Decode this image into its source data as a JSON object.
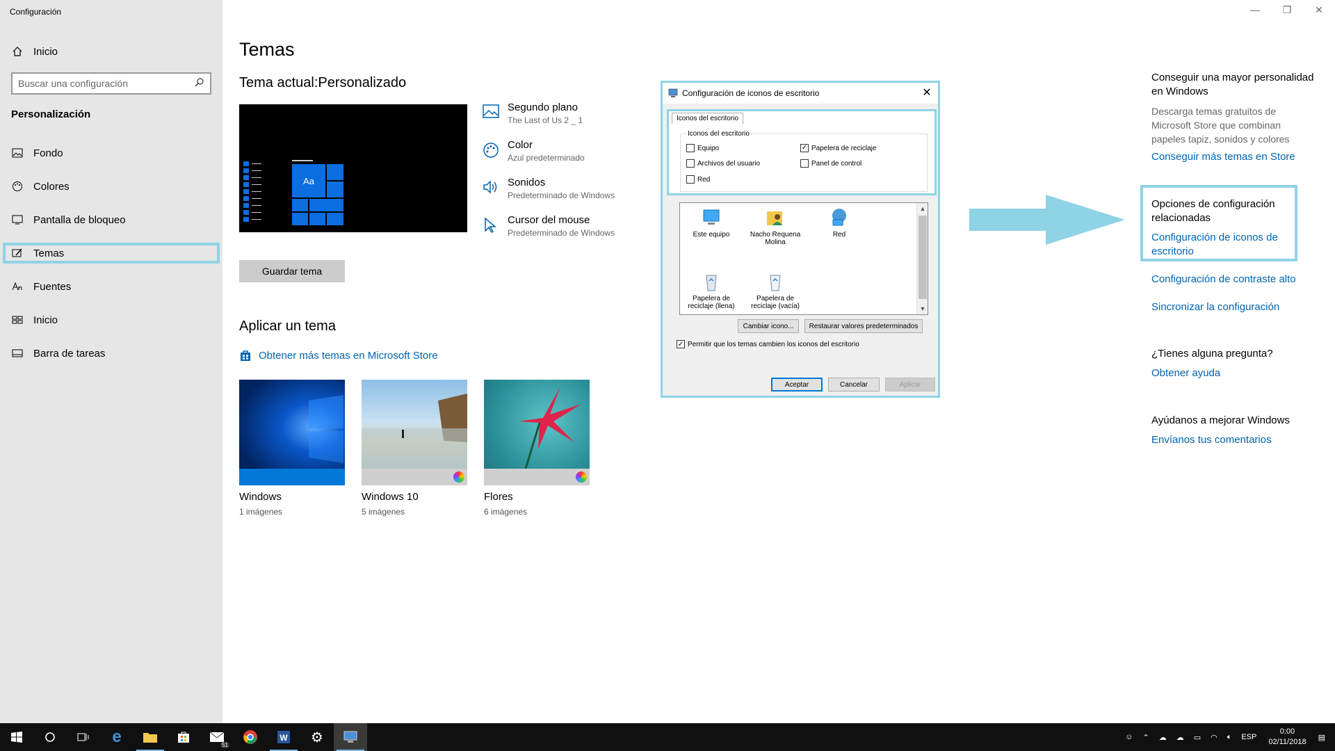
{
  "app_title": "Configuración",
  "sidebar": {
    "home_label": "Inicio",
    "search_placeholder": "Buscar una configuración",
    "section_heading": "Personalización",
    "items": [
      {
        "label": "Fondo",
        "icon": "picture-icon"
      },
      {
        "label": "Colores",
        "icon": "palette-icon"
      },
      {
        "label": "Pantalla de bloqueo",
        "icon": "monitor-icon"
      },
      {
        "label": "Temas",
        "icon": "brush-icon",
        "active": true
      },
      {
        "label": "Fuentes",
        "icon": "font-icon"
      },
      {
        "label": "Inicio",
        "icon": "start-icon"
      },
      {
        "label": "Barra de tareas",
        "icon": "taskbar-icon"
      }
    ]
  },
  "main": {
    "title": "Temas",
    "current_theme": "Tema actual:Personalizado",
    "preview_tile_label": "Aa",
    "save_button": "Guardar tema",
    "settings": [
      {
        "title": "Segundo plano",
        "subtitle": "The Last of Us 2 _ 1",
        "icon": "picture-icon"
      },
      {
        "title": "Color",
        "subtitle": "Azul predeterminado",
        "icon": "palette-icon"
      },
      {
        "title": "Sonidos",
        "subtitle": "Predeterminado de Windows",
        "icon": "speaker-icon"
      },
      {
        "title": "Cursor del mouse",
        "subtitle": "Predeterminado de Windows",
        "icon": "cursor-icon"
      }
    ],
    "apply_heading": "Aplicar un tema",
    "store_link": "Obtener más temas en Microsoft Store",
    "themes": [
      {
        "name": "Windows",
        "count": "1 imágenes"
      },
      {
        "name": "Windows 10",
        "count": "5 imágenes"
      },
      {
        "name": "Flores",
        "count": "6 imágenes"
      }
    ]
  },
  "dialog": {
    "title": "Configuración de iconos de escritorio",
    "tab": "Iconos del escritorio",
    "group_label": "Iconos del escritorio",
    "checkboxes": [
      {
        "label": "Equipo",
        "checked": false
      },
      {
        "label": "Papelera de reciclaje",
        "checked": true
      },
      {
        "label": "Archivos del usuario",
        "checked": false
      },
      {
        "label": "Panel de control",
        "checked": false
      },
      {
        "label": "Red",
        "checked": false
      }
    ],
    "icons": [
      {
        "label": "Este equipo"
      },
      {
        "label": "Nacho Requena Molina"
      },
      {
        "label": "Red"
      },
      {
        "label": "Papelera de reciclaje (llena)"
      },
      {
        "label": "Papelera de reciclaje (vacía)"
      }
    ],
    "change_icon_button": "Cambiar icono...",
    "restore_button": "Restaurar valores predeterminados",
    "allow_themes_checkbox": "Permitir que los temas cambien los iconos del escritorio",
    "allow_themes_checked": true,
    "ok_button": "Aceptar",
    "cancel_button": "Cancelar",
    "apply_button": "Aplicar"
  },
  "right_pane": {
    "more_heading": "Conseguir una mayor personalidad en Windows",
    "more_text": "Descarga temas gratuitos de Microsoft Store que combinan papeles tapiz, sonidos y colores",
    "more_link": "Conseguir más temas en Store",
    "related_heading": "Opciones de configuración relacionadas",
    "related_link_icons": "Configuración de iconos de escritorio",
    "related_link_contrast": "Configuración de contraste alto",
    "related_link_sync": "Sincronizar la configuración",
    "question_heading": "¿Tienes alguna pregunta?",
    "help_link": "Obtener ayuda",
    "improve_heading": "Ayúdanos a mejorar Windows",
    "feedback_link": "Envíanos tus comentarios"
  },
  "taskbar": {
    "mail_badge": "51",
    "language": "ESP",
    "time": "0:00",
    "date": "02/11/2018"
  },
  "colors": {
    "accent": "#0078d7",
    "link": "#0063b1",
    "highlight": "#8fd3e6"
  }
}
